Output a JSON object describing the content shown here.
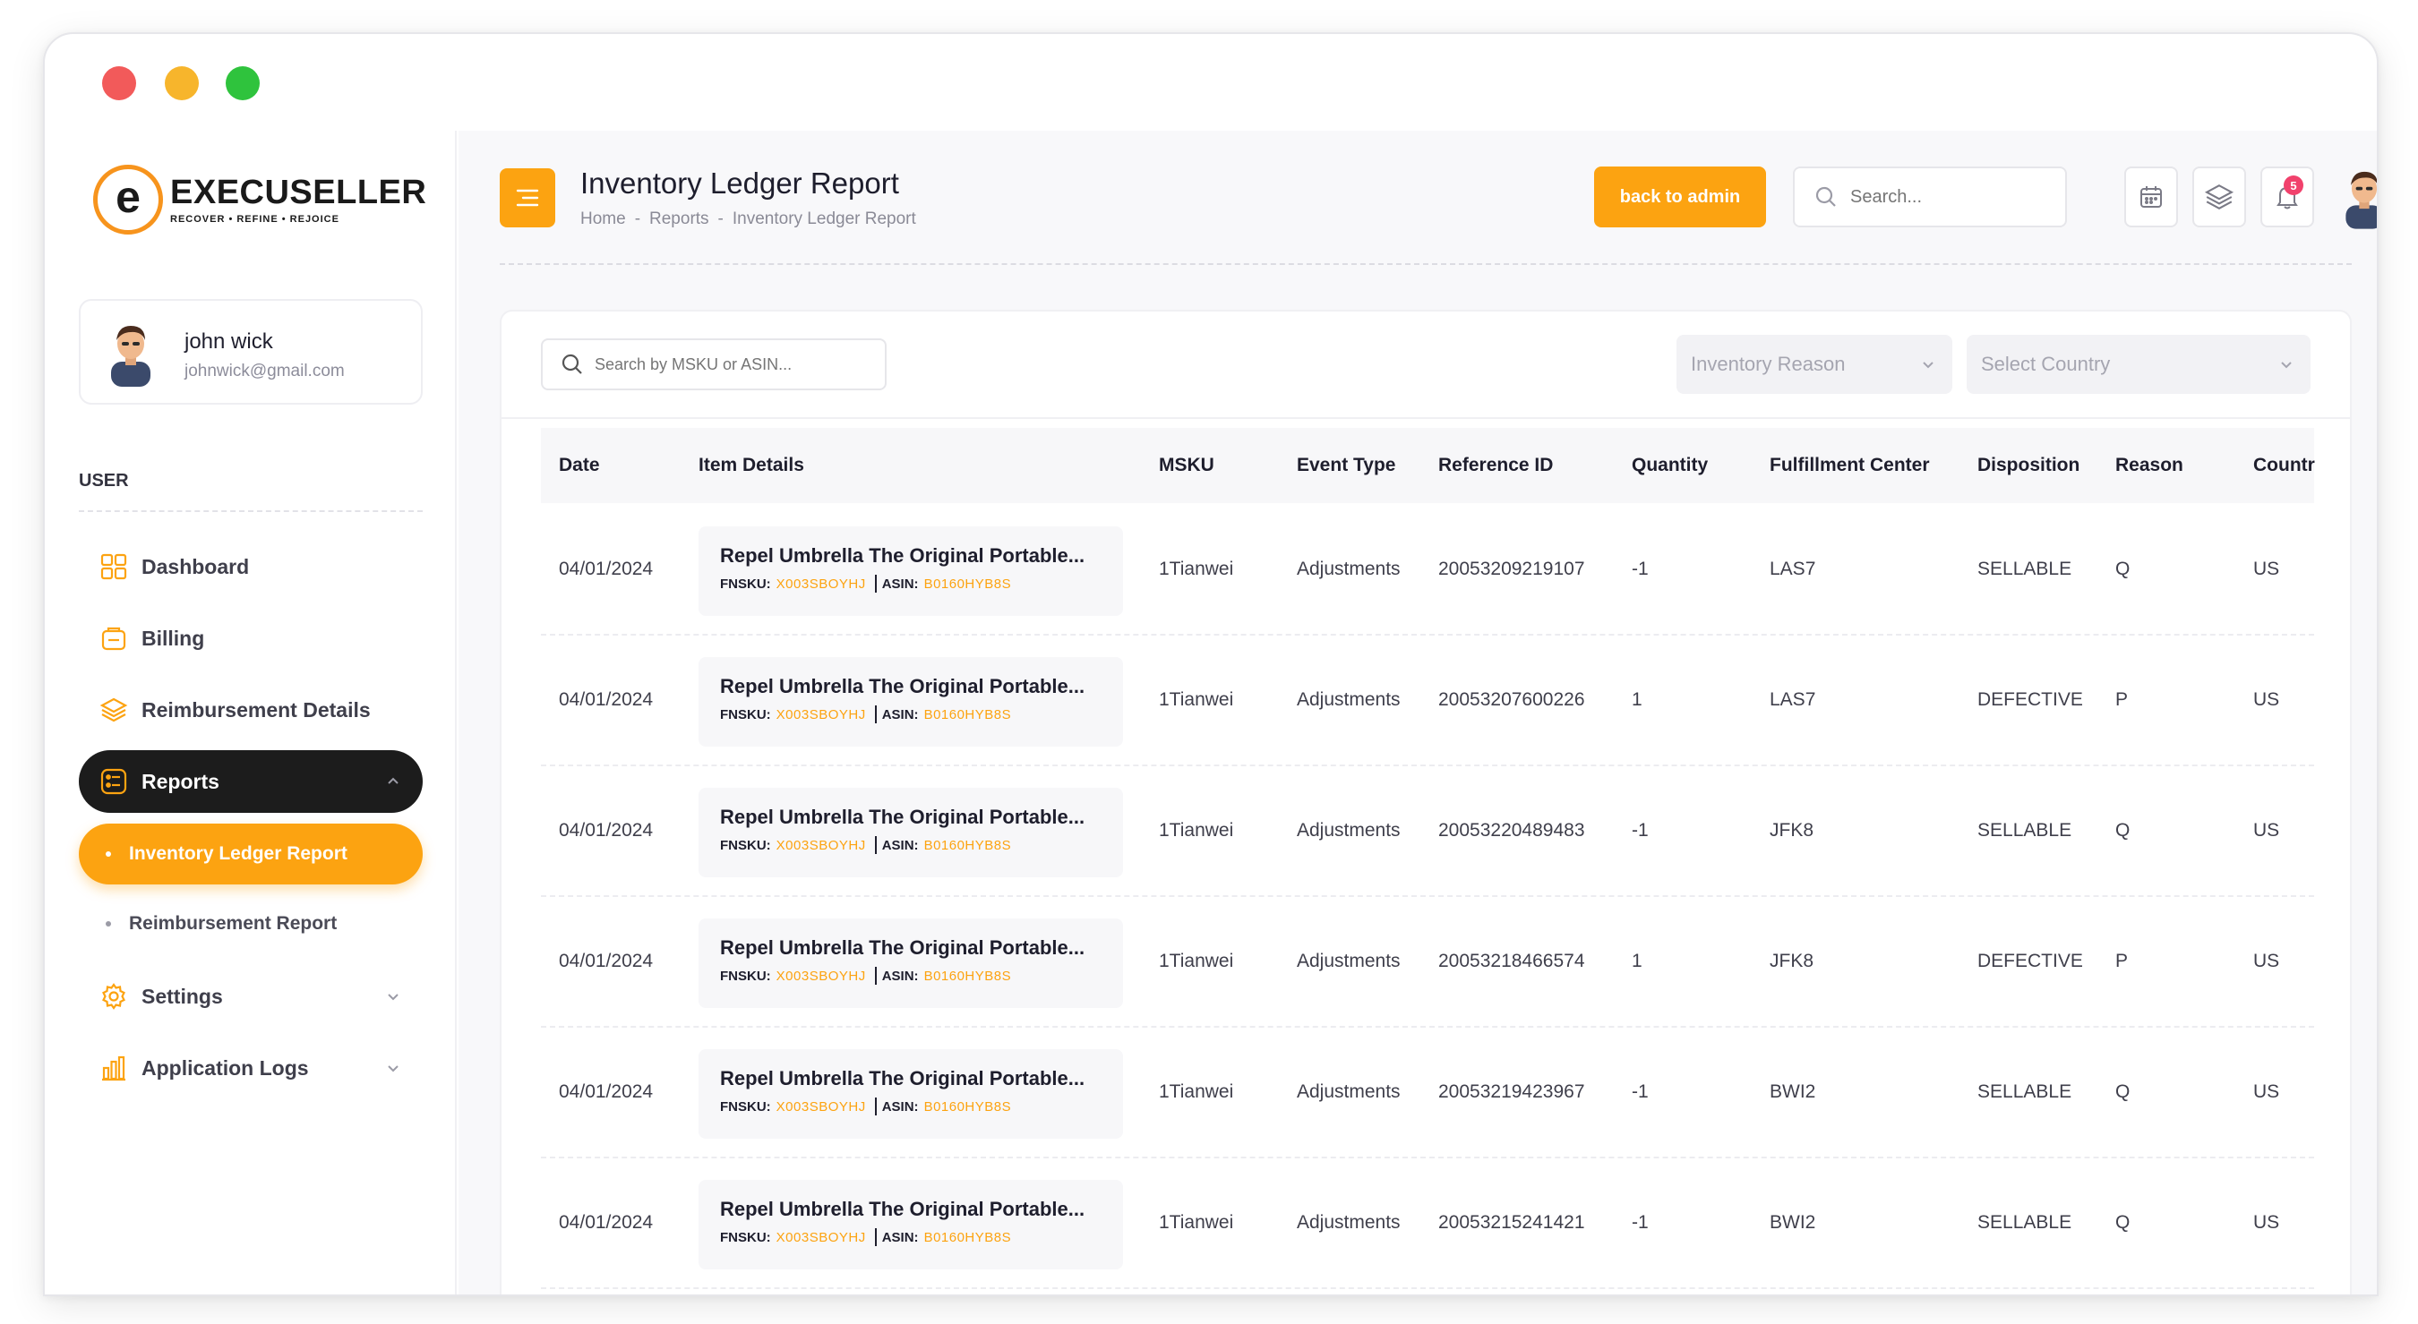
{
  "brand": {
    "name": "EXECUSELLER",
    "letter": "e",
    "tagline": "RECOVER • REFINE • REJOICE",
    "accent": "#fca311"
  },
  "user": {
    "name": "john wick",
    "email": "johnwick@gmail.com"
  },
  "sidebar": {
    "section_label": "USER",
    "items": [
      {
        "label": "Dashboard",
        "icon": "dashboard-grid-icon"
      },
      {
        "label": "Billing",
        "icon": "billing-icon"
      },
      {
        "label": "Reimbursement Details",
        "icon": "layers-icon"
      },
      {
        "label": "Reports",
        "icon": "reports-icon",
        "expanded": true
      },
      {
        "label": "Settings",
        "icon": "gear-icon"
      },
      {
        "label": "Application Logs",
        "icon": "bar-chart-icon"
      }
    ],
    "sub_items": [
      {
        "label": "Inventory Ledger Report",
        "active": true
      },
      {
        "label": "Reimbursement Report",
        "active": false
      }
    ]
  },
  "header": {
    "title": "Inventory Ledger Report",
    "breadcrumb": [
      "Home",
      "Reports",
      "Inventory Ledger Report"
    ],
    "breadcrumb_sep": "-",
    "back_button": "back to admin",
    "search_placeholder": "Search...",
    "notification_count": "5"
  },
  "filters": {
    "search_placeholder": "Search by MSKU or ASIN...",
    "reason_select": "Inventory Reason",
    "country_select": "Select Country"
  },
  "table": {
    "columns": [
      "Date",
      "Item Details",
      "MSKU",
      "Event Type",
      "Reference ID",
      "Quantity",
      "Fulfillment Center",
      "Disposition",
      "Reason",
      "Countr"
    ],
    "fnsku_label": "FNSKU:",
    "asin_label": "ASIN:",
    "rows": [
      {
        "date": "04/01/2024",
        "title": "Repel Umbrella The Original Portable...",
        "fnsku": "X003SBOYHJ",
        "asin": "B0160HYB8S",
        "msku": "1Tianwei",
        "event": "Adjustments",
        "ref": "20053209219107",
        "qty": "-1",
        "fc": "LAS7",
        "disposition": "SELLABLE",
        "reason": "Q",
        "country": "US"
      },
      {
        "date": "04/01/2024",
        "title": "Repel Umbrella The Original Portable...",
        "fnsku": "X003SBOYHJ",
        "asin": "B0160HYB8S",
        "msku": "1Tianwei",
        "event": "Adjustments",
        "ref": "20053207600226",
        "qty": "1",
        "fc": "LAS7",
        "disposition": "DEFECTIVE",
        "reason": "P",
        "country": "US"
      },
      {
        "date": "04/01/2024",
        "title": "Repel Umbrella The Original Portable...",
        "fnsku": "X003SBOYHJ",
        "asin": "B0160HYB8S",
        "msku": "1Tianwei",
        "event": "Adjustments",
        "ref": "20053220489483",
        "qty": "-1",
        "fc": "JFK8",
        "disposition": "SELLABLE",
        "reason": "Q",
        "country": "US"
      },
      {
        "date": "04/01/2024",
        "title": "Repel Umbrella The Original Portable...",
        "fnsku": "X003SBOYHJ",
        "asin": "B0160HYB8S",
        "msku": "1Tianwei",
        "event": "Adjustments",
        "ref": "20053218466574",
        "qty": "1",
        "fc": "JFK8",
        "disposition": "DEFECTIVE",
        "reason": "P",
        "country": "US"
      },
      {
        "date": "04/01/2024",
        "title": "Repel Umbrella The Original Portable...",
        "fnsku": "X003SBOYHJ",
        "asin": "B0160HYB8S",
        "msku": "1Tianwei",
        "event": "Adjustments",
        "ref": "20053219423967",
        "qty": "-1",
        "fc": "BWI2",
        "disposition": "SELLABLE",
        "reason": "Q",
        "country": "US"
      },
      {
        "date": "04/01/2024",
        "title": "Repel Umbrella The Original Portable...",
        "fnsku": "X003SBOYHJ",
        "asin": "B0160HYB8S",
        "msku": "1Tianwei",
        "event": "Adjustments",
        "ref": "20053215241421",
        "qty": "-1",
        "fc": "BWI2",
        "disposition": "SELLABLE",
        "reason": "Q",
        "country": "US"
      }
    ]
  }
}
